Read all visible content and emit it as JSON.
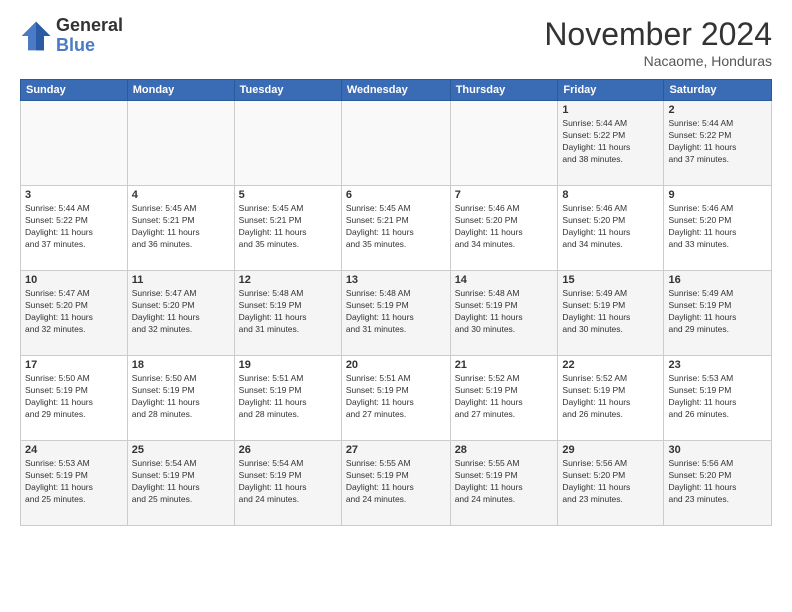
{
  "logo": {
    "general": "General",
    "blue": "Blue"
  },
  "title": "November 2024",
  "location": "Nacaome, Honduras",
  "weekdays": [
    "Sunday",
    "Monday",
    "Tuesday",
    "Wednesday",
    "Thursday",
    "Friday",
    "Saturday"
  ],
  "weeks": [
    [
      {
        "day": "",
        "info": ""
      },
      {
        "day": "",
        "info": ""
      },
      {
        "day": "",
        "info": ""
      },
      {
        "day": "",
        "info": ""
      },
      {
        "day": "",
        "info": ""
      },
      {
        "day": "1",
        "info": "Sunrise: 5:44 AM\nSunset: 5:22 PM\nDaylight: 11 hours\nand 38 minutes."
      },
      {
        "day": "2",
        "info": "Sunrise: 5:44 AM\nSunset: 5:22 PM\nDaylight: 11 hours\nand 37 minutes."
      }
    ],
    [
      {
        "day": "3",
        "info": "Sunrise: 5:44 AM\nSunset: 5:22 PM\nDaylight: 11 hours\nand 37 minutes."
      },
      {
        "day": "4",
        "info": "Sunrise: 5:45 AM\nSunset: 5:21 PM\nDaylight: 11 hours\nand 36 minutes."
      },
      {
        "day": "5",
        "info": "Sunrise: 5:45 AM\nSunset: 5:21 PM\nDaylight: 11 hours\nand 35 minutes."
      },
      {
        "day": "6",
        "info": "Sunrise: 5:45 AM\nSunset: 5:21 PM\nDaylight: 11 hours\nand 35 minutes."
      },
      {
        "day": "7",
        "info": "Sunrise: 5:46 AM\nSunset: 5:20 PM\nDaylight: 11 hours\nand 34 minutes."
      },
      {
        "day": "8",
        "info": "Sunrise: 5:46 AM\nSunset: 5:20 PM\nDaylight: 11 hours\nand 34 minutes."
      },
      {
        "day": "9",
        "info": "Sunrise: 5:46 AM\nSunset: 5:20 PM\nDaylight: 11 hours\nand 33 minutes."
      }
    ],
    [
      {
        "day": "10",
        "info": "Sunrise: 5:47 AM\nSunset: 5:20 PM\nDaylight: 11 hours\nand 32 minutes."
      },
      {
        "day": "11",
        "info": "Sunrise: 5:47 AM\nSunset: 5:20 PM\nDaylight: 11 hours\nand 32 minutes."
      },
      {
        "day": "12",
        "info": "Sunrise: 5:48 AM\nSunset: 5:19 PM\nDaylight: 11 hours\nand 31 minutes."
      },
      {
        "day": "13",
        "info": "Sunrise: 5:48 AM\nSunset: 5:19 PM\nDaylight: 11 hours\nand 31 minutes."
      },
      {
        "day": "14",
        "info": "Sunrise: 5:48 AM\nSunset: 5:19 PM\nDaylight: 11 hours\nand 30 minutes."
      },
      {
        "day": "15",
        "info": "Sunrise: 5:49 AM\nSunset: 5:19 PM\nDaylight: 11 hours\nand 30 minutes."
      },
      {
        "day": "16",
        "info": "Sunrise: 5:49 AM\nSunset: 5:19 PM\nDaylight: 11 hours\nand 29 minutes."
      }
    ],
    [
      {
        "day": "17",
        "info": "Sunrise: 5:50 AM\nSunset: 5:19 PM\nDaylight: 11 hours\nand 29 minutes."
      },
      {
        "day": "18",
        "info": "Sunrise: 5:50 AM\nSunset: 5:19 PM\nDaylight: 11 hours\nand 28 minutes."
      },
      {
        "day": "19",
        "info": "Sunrise: 5:51 AM\nSunset: 5:19 PM\nDaylight: 11 hours\nand 28 minutes."
      },
      {
        "day": "20",
        "info": "Sunrise: 5:51 AM\nSunset: 5:19 PM\nDaylight: 11 hours\nand 27 minutes."
      },
      {
        "day": "21",
        "info": "Sunrise: 5:52 AM\nSunset: 5:19 PM\nDaylight: 11 hours\nand 27 minutes."
      },
      {
        "day": "22",
        "info": "Sunrise: 5:52 AM\nSunset: 5:19 PM\nDaylight: 11 hours\nand 26 minutes."
      },
      {
        "day": "23",
        "info": "Sunrise: 5:53 AM\nSunset: 5:19 PM\nDaylight: 11 hours\nand 26 minutes."
      }
    ],
    [
      {
        "day": "24",
        "info": "Sunrise: 5:53 AM\nSunset: 5:19 PM\nDaylight: 11 hours\nand 25 minutes."
      },
      {
        "day": "25",
        "info": "Sunrise: 5:54 AM\nSunset: 5:19 PM\nDaylight: 11 hours\nand 25 minutes."
      },
      {
        "day": "26",
        "info": "Sunrise: 5:54 AM\nSunset: 5:19 PM\nDaylight: 11 hours\nand 24 minutes."
      },
      {
        "day": "27",
        "info": "Sunrise: 5:55 AM\nSunset: 5:19 PM\nDaylight: 11 hours\nand 24 minutes."
      },
      {
        "day": "28",
        "info": "Sunrise: 5:55 AM\nSunset: 5:19 PM\nDaylight: 11 hours\nand 24 minutes."
      },
      {
        "day": "29",
        "info": "Sunrise: 5:56 AM\nSunset: 5:20 PM\nDaylight: 11 hours\nand 23 minutes."
      },
      {
        "day": "30",
        "info": "Sunrise: 5:56 AM\nSunset: 5:20 PM\nDaylight: 11 hours\nand 23 minutes."
      }
    ]
  ]
}
